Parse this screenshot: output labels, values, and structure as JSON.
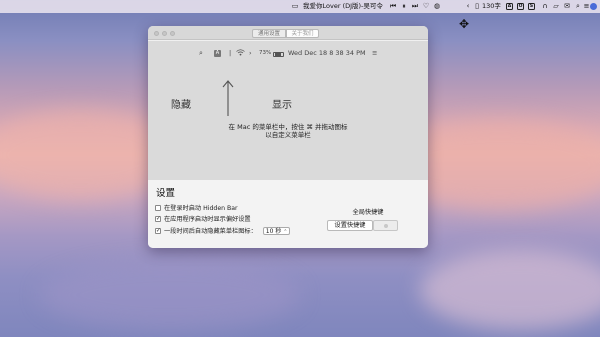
{
  "menubar": {
    "song": "我爱你Lover (DJ版)-吴可令",
    "ime_label": "130字",
    "icons": [
      "video-camera-icon",
      "prev-track-icon",
      "pause-icon",
      "next-track-icon",
      "heart-icon",
      "profile-icon",
      "chevron-left-icon",
      "tablet-icon",
      "box-a-icon",
      "box-o-icon",
      "box-s-icon",
      "headphones-icon",
      "folder-icon",
      "mail-icon",
      "search-icon",
      "list-icon",
      "account-icon",
      "chrome-icon"
    ]
  },
  "window": {
    "tabs": {
      "general": "通用设置",
      "about": "关于我们"
    },
    "preview": {
      "battery": "73%",
      "clock": "Wed Dec 18  8 38 34 PM",
      "status_icons": [
        "search-icon",
        "a-icon",
        "separator-bar-icon",
        "wifi-icon",
        "chevron-right-icon",
        "battery-icon",
        "list-icon"
      ],
      "hidden_label": "隐藏",
      "shown_label": "显示",
      "description_line1": "在 Mac 的菜单栏中，按住 ⌘ 并拖动图标",
      "description_line2": "以自定义菜单栏"
    },
    "settings": {
      "title": "设置",
      "options": [
        {
          "label": "在登录时启动 Hidden Bar",
          "checked": false
        },
        {
          "label": "在应用程序启动时显示偏好设置",
          "checked": true
        },
        {
          "label": "一段时间后自动隐藏菜单栏图标：",
          "checked": true
        }
      ],
      "autohide_value": "10 秒",
      "hotkey_title": "全局快捷键",
      "hotkey_button": "设置快捷键"
    }
  }
}
